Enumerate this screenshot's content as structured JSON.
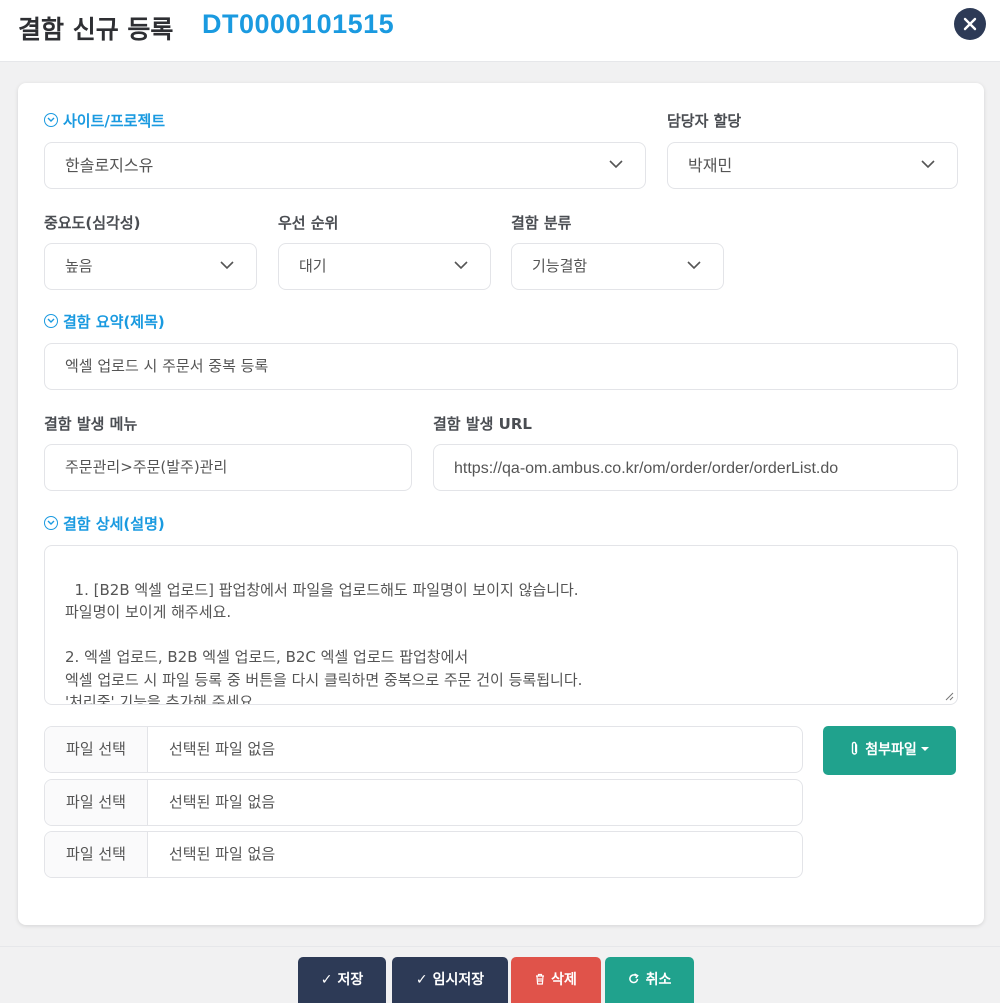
{
  "header": {
    "title": "결함 신규 등록",
    "defect_id": "DT0000101515"
  },
  "colors": {
    "accent": "#1a9ae0",
    "navy": "#2d3a56",
    "teal": "#20a28d",
    "danger": "#e0534a"
  },
  "form": {
    "site_project": {
      "label": "사이트/프로젝트",
      "value": "한솔로지스유"
    },
    "assignee": {
      "label": "담당자 할당",
      "value": "박재민"
    },
    "severity": {
      "label": "중요도(심각성)",
      "value": "높음"
    },
    "priority": {
      "label": "우선 순위",
      "value": "대기"
    },
    "category": {
      "label": "결함 분류",
      "value": "기능결함"
    },
    "summary": {
      "label": "결함 요약(제목)",
      "value": "엑셀 업로드 시 주문서 중복 등록"
    },
    "menu": {
      "label": "결함 발생 메뉴",
      "value": "주문관리>주문(발주)관리"
    },
    "url": {
      "label": "결함 발생 URL",
      "value": "https://qa-om.ambus.co.kr/om/order/order/orderList.do"
    },
    "detail": {
      "label": "결함 상세(설명)",
      "value": "1. [B2B 엑셀 업로드] 팝업창에서 파일을 업로드해도 파일명이 보이지 않습니다.\n파일명이 보이게 해주세요.\n\n2. 엑셀 업로드, B2B 엑셀 업로드, B2C 엑셀 업로드 팝업창에서\n엑셀 업로드 시 파일 등록 중 버튼을 다시 클릭하면 중복으로 주문 건이 등록됩니다.\n'처리중' 기능을 추가해 주세요."
    }
  },
  "files": [
    {
      "button": "파일 선택",
      "status": "선택된 파일 없음"
    },
    {
      "button": "파일 선택",
      "status": "선택된 파일 없음"
    },
    {
      "button": "파일 선택",
      "status": "선택된 파일 없음"
    }
  ],
  "attach_button": "첨부파일",
  "footer": {
    "save": "저장",
    "temp_save": "임시저장",
    "delete": "삭제",
    "cancel": "취소"
  },
  "icons": {
    "close": "close-icon",
    "chevron": "chevron-down-icon",
    "section": "circle-chevron-icon",
    "paperclip": "paperclip-icon",
    "check": "check-icon",
    "trash": "trash-icon",
    "redo": "redo-icon"
  }
}
